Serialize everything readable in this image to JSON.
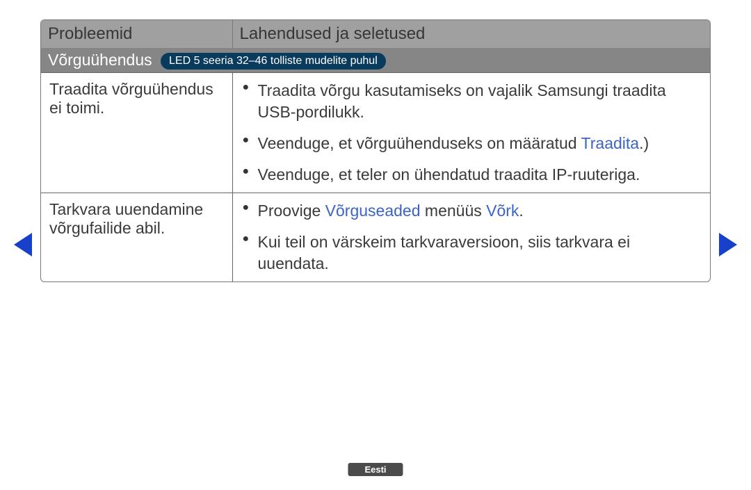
{
  "headers": {
    "problems": "Probleemid",
    "solutions": "Lahendused ja seletused"
  },
  "section": {
    "title": "Võrguühendus",
    "pill": "LED 5 seeria 32–46 tolliste mudelite puhul"
  },
  "rows": [
    {
      "problem": "Traadita võrguühendus ei toimi.",
      "solutions": [
        {
          "pre": "Traadita võrgu kasutamiseks on vajalik Samsungi traadita USB-pordilukk."
        },
        {
          "pre": "Veenduge, et võrguühenduseks on määratud ",
          "hl": "Traadita",
          "post": ".)"
        },
        {
          "pre": "Veenduge, et teler on ühendatud traadita IP-ruuteriga."
        }
      ]
    },
    {
      "problem": "Tarkvara uuendamine võrgufailide abil.",
      "solutions": [
        {
          "pre": "Proovige ",
          "hl": "Võrguseaded",
          "mid": " menüüs ",
          "hl2": "Võrk",
          "post": "."
        },
        {
          "pre": "Kui teil on värskeim tarkvaraversioon, siis tarkvara ei uuendata."
        }
      ]
    }
  ],
  "footer": {
    "language": "Eesti"
  }
}
